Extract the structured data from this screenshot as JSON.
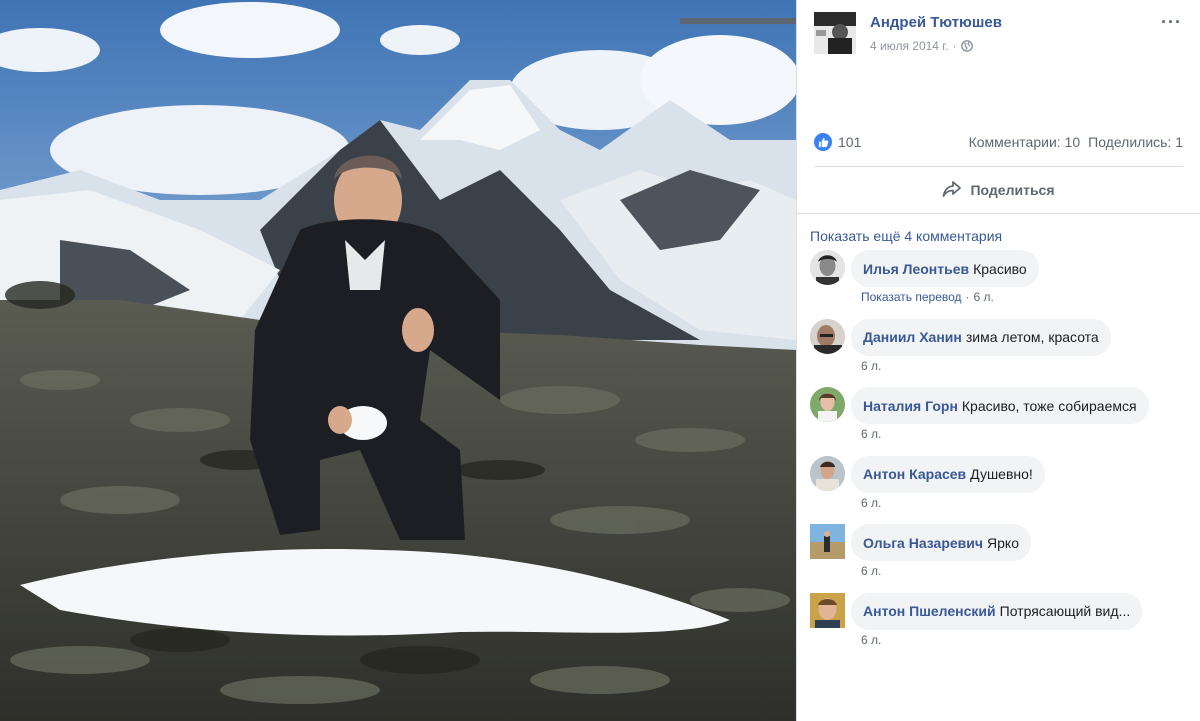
{
  "post": {
    "author": "Андрей Тютюшев",
    "date": "4 июля 2014 г.",
    "separator": "·",
    "more_label": "···"
  },
  "stats": {
    "likes": "101",
    "comments": "Комментарии: 10",
    "shares": "Поделились: 1"
  },
  "actions": {
    "share_label": "Поделиться"
  },
  "comments_section": {
    "show_more": "Показать ещё 4 комментария",
    "items": [
      {
        "name": "Илья Леонтьев",
        "text": "Красиво",
        "translate": "Показать перевод",
        "time": "6 л."
      },
      {
        "name": "Даниил Ханин",
        "text": "зима летом, красота",
        "time": "6 л."
      },
      {
        "name": "Наталия Горн",
        "text": "Красиво, тоже собираемся",
        "time": "6 л."
      },
      {
        "name": "Антон Карасев",
        "text": "Душевно!",
        "time": "6 л."
      },
      {
        "name": "Ольга Назаревич",
        "text": "Ярко",
        "time": "6 л."
      },
      {
        "name": "Антон Пшеленский",
        "text": "Потрясающий вид...",
        "time": "6 л."
      }
    ]
  },
  "icons": [
    "globe-icon",
    "like-icon",
    "share-icon",
    "more-icon"
  ],
  "colors": {
    "link": "#385898",
    "like": "#3b82f6",
    "bubble": "#f2f3f5",
    "meta": "#90949c"
  }
}
